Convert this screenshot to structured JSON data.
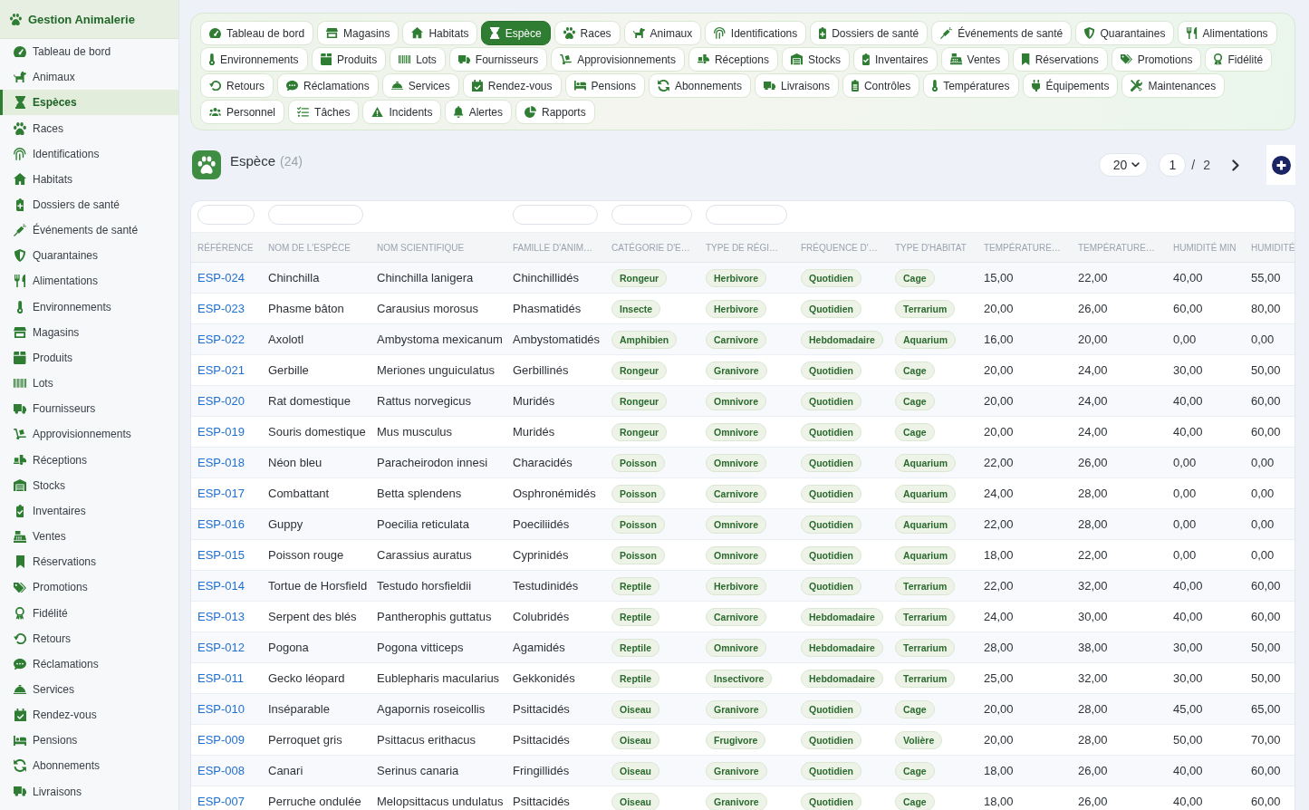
{
  "sidebar": {
    "title": "Gestion Animalerie",
    "items": [
      {
        "label": "Tableau de bord",
        "selected": false
      },
      {
        "label": "Animaux",
        "selected": false
      },
      {
        "label": "Espèces",
        "selected": true
      },
      {
        "label": "Races",
        "selected": false
      },
      {
        "label": "Identifications",
        "selected": false
      },
      {
        "label": "Habitats",
        "selected": false
      },
      {
        "label": "Dossiers de santé",
        "selected": false
      },
      {
        "label": "Événements de santé",
        "selected": false
      },
      {
        "label": "Quarantaines",
        "selected": false
      },
      {
        "label": "Alimentations",
        "selected": false
      },
      {
        "label": "Environnements",
        "selected": false
      },
      {
        "label": "Magasins",
        "selected": false
      },
      {
        "label": "Produits",
        "selected": false
      },
      {
        "label": "Lots",
        "selected": false
      },
      {
        "label": "Fournisseurs",
        "selected": false
      },
      {
        "label": "Approvisionnements",
        "selected": false
      },
      {
        "label": "Réceptions",
        "selected": false
      },
      {
        "label": "Stocks",
        "selected": false
      },
      {
        "label": "Inventaires",
        "selected": false
      },
      {
        "label": "Ventes",
        "selected": false
      },
      {
        "label": "Réservations",
        "selected": false
      },
      {
        "label": "Promotions",
        "selected": false
      },
      {
        "label": "Fidélité",
        "selected": false
      },
      {
        "label": "Retours",
        "selected": false
      },
      {
        "label": "Réclamations",
        "selected": false
      },
      {
        "label": "Services",
        "selected": false
      },
      {
        "label": "Rendez-vous",
        "selected": false
      },
      {
        "label": "Pensions",
        "selected": false
      },
      {
        "label": "Abonnements",
        "selected": false
      },
      {
        "label": "Livraisons",
        "selected": false
      }
    ]
  },
  "tabs": [
    {
      "label": "Tableau de bord",
      "selected": false
    },
    {
      "label": "Magasins",
      "selected": false
    },
    {
      "label": "Habitats",
      "selected": false
    },
    {
      "label": "Espèce",
      "selected": true
    },
    {
      "label": "Races",
      "selected": false
    },
    {
      "label": "Animaux",
      "selected": false
    },
    {
      "label": "Identifications",
      "selected": false
    },
    {
      "label": "Dossiers de santé",
      "selected": false
    },
    {
      "label": "Événements de santé",
      "selected": false
    },
    {
      "label": "Quarantaines",
      "selected": false
    },
    {
      "label": "Alimentations",
      "selected": false
    },
    {
      "label": "Environnements",
      "selected": false
    },
    {
      "label": "Produits",
      "selected": false
    },
    {
      "label": "Lots",
      "selected": false
    },
    {
      "label": "Fournisseurs",
      "selected": false
    },
    {
      "label": "Approvisionnements",
      "selected": false
    },
    {
      "label": "Réceptions",
      "selected": false
    },
    {
      "label": "Stocks",
      "selected": false
    },
    {
      "label": "Inventaires",
      "selected": false
    },
    {
      "label": "Ventes",
      "selected": false
    },
    {
      "label": "Réservations",
      "selected": false
    },
    {
      "label": "Promotions",
      "selected": false
    },
    {
      "label": "Fidélité",
      "selected": false
    },
    {
      "label": "Retours",
      "selected": false
    },
    {
      "label": "Réclamations",
      "selected": false
    },
    {
      "label": "Services",
      "selected": false
    },
    {
      "label": "Rendez-vous",
      "selected": false
    },
    {
      "label": "Pensions",
      "selected": false
    },
    {
      "label": "Abonnements",
      "selected": false
    },
    {
      "label": "Livraisons",
      "selected": false
    },
    {
      "label": "Contrôles",
      "selected": false
    },
    {
      "label": "Températures",
      "selected": false
    },
    {
      "label": "Équipements",
      "selected": false
    },
    {
      "label": "Maintenances",
      "selected": false
    },
    {
      "label": "Personnel",
      "selected": false
    },
    {
      "label": "Tâches",
      "selected": false
    },
    {
      "label": "Incidents",
      "selected": false
    },
    {
      "label": "Alertes",
      "selected": false
    },
    {
      "label": "Rapports",
      "selected": false
    }
  ],
  "header": {
    "title": "Espèce",
    "count": "(24)"
  },
  "pagination": {
    "page_size": "20",
    "page": "1",
    "separator": "/",
    "total_pages": "2"
  },
  "table": {
    "columns": [
      {
        "label": "RÉFÉRENCE",
        "kind": "link",
        "filter": true
      },
      {
        "label": "NOM DE L'ESPÈCE",
        "kind": "text",
        "filter": true
      },
      {
        "label": "NOM SCIENTIFIQUE",
        "kind": "text",
        "filter": false
      },
      {
        "label": "FAMILLE D'ANIM…",
        "kind": "text",
        "filter": true
      },
      {
        "label": "CATÉGORIE D'E…",
        "kind": "badge",
        "filter": true
      },
      {
        "label": "TYPE DE RÉGI…",
        "kind": "badge",
        "filter": true
      },
      {
        "label": "FRÉQUENCE D'…",
        "kind": "badge",
        "filter": false
      },
      {
        "label": "TYPE D'HABITAT",
        "kind": "badge",
        "filter": false
      },
      {
        "label": "TEMPÉRATURE…",
        "kind": "text",
        "filter": false
      },
      {
        "label": "TEMPÉRATURE…",
        "kind": "text",
        "filter": false
      },
      {
        "label": "HUMIDITÉ MIN",
        "kind": "text",
        "filter": false
      },
      {
        "label": "HUMIDITÉ",
        "kind": "text",
        "filter": false
      }
    ],
    "rows": [
      [
        "ESP-024",
        "Chinchilla",
        "Chinchilla lanigera",
        "Chinchillidés",
        "Rongeur",
        "Herbivore",
        "Quotidien",
        "Cage",
        "15,00",
        "22,00",
        "40,00",
        "55,00"
      ],
      [
        "ESP-023",
        "Phasme bâton",
        "Carausius morosus",
        "Phasmatidés",
        "Insecte",
        "Herbivore",
        "Quotidien",
        "Terrarium",
        "20,00",
        "26,00",
        "60,00",
        "80,00"
      ],
      [
        "ESP-022",
        "Axolotl",
        "Ambystoma mexicanum",
        "Ambystomatidés",
        "Amphibien",
        "Carnivore",
        "Hebdomadaire",
        "Aquarium",
        "16,00",
        "20,00",
        "0,00",
        "0,00"
      ],
      [
        "ESP-021",
        "Gerbille",
        "Meriones unguiculatus",
        "Gerbillinés",
        "Rongeur",
        "Granivore",
        "Quotidien",
        "Cage",
        "20,00",
        "24,00",
        "30,00",
        "50,00"
      ],
      [
        "ESP-020",
        "Rat domestique",
        "Rattus norvegicus",
        "Muridés",
        "Rongeur",
        "Omnivore",
        "Quotidien",
        "Cage",
        "20,00",
        "24,00",
        "40,00",
        "60,00"
      ],
      [
        "ESP-019",
        "Souris domestique",
        "Mus musculus",
        "Muridés",
        "Rongeur",
        "Omnivore",
        "Quotidien",
        "Cage",
        "20,00",
        "24,00",
        "40,00",
        "60,00"
      ],
      [
        "ESP-018",
        "Néon bleu",
        "Paracheirodon innesi",
        "Characidés",
        "Poisson",
        "Omnivore",
        "Quotidien",
        "Aquarium",
        "22,00",
        "26,00",
        "0,00",
        "0,00"
      ],
      [
        "ESP-017",
        "Combattant",
        "Betta splendens",
        "Osphronémidés",
        "Poisson",
        "Carnivore",
        "Quotidien",
        "Aquarium",
        "24,00",
        "28,00",
        "0,00",
        "0,00"
      ],
      [
        "ESP-016",
        "Guppy",
        "Poecilia reticulata",
        "Poeciliidés",
        "Poisson",
        "Omnivore",
        "Quotidien",
        "Aquarium",
        "22,00",
        "28,00",
        "0,00",
        "0,00"
      ],
      [
        "ESP-015",
        "Poisson rouge",
        "Carassius auratus",
        "Cyprinidés",
        "Poisson",
        "Omnivore",
        "Quotidien",
        "Aquarium",
        "18,00",
        "22,00",
        "0,00",
        "0,00"
      ],
      [
        "ESP-014",
        "Tortue de Horsfield",
        "Testudo horsfieldii",
        "Testudinidés",
        "Reptile",
        "Herbivore",
        "Quotidien",
        "Terrarium",
        "22,00",
        "32,00",
        "40,00",
        "60,00"
      ],
      [
        "ESP-013",
        "Serpent des blés",
        "Pantherophis guttatus",
        "Colubridés",
        "Reptile",
        "Carnivore",
        "Hebdomadaire",
        "Terrarium",
        "24,00",
        "30,00",
        "40,00",
        "60,00"
      ],
      [
        "ESP-012",
        "Pogona",
        "Pogona vitticeps",
        "Agamidés",
        "Reptile",
        "Omnivore",
        "Hebdomadaire",
        "Terrarium",
        "28,00",
        "38,00",
        "30,00",
        "50,00"
      ],
      [
        "ESP-011",
        "Gecko léopard",
        "Eublepharis macularius",
        "Gekkonidés",
        "Reptile",
        "Insectivore",
        "Hebdomadaire",
        "Terrarium",
        "25,00",
        "32,00",
        "30,00",
        "50,00"
      ],
      [
        "ESP-010",
        "Inséparable",
        "Agapornis roseicollis",
        "Psittacidés",
        "Oiseau",
        "Granivore",
        "Quotidien",
        "Cage",
        "20,00",
        "28,00",
        "45,00",
        "65,00"
      ],
      [
        "ESP-009",
        "Perroquet gris",
        "Psittacus erithacus",
        "Psittacidés",
        "Oiseau",
        "Frugivore",
        "Quotidien",
        "Volière",
        "20,00",
        "28,00",
        "50,00",
        "70,00"
      ],
      [
        "ESP-008",
        "Canari",
        "Serinus canaria",
        "Fringillidés",
        "Oiseau",
        "Granivore",
        "Quotidien",
        "Cage",
        "18,00",
        "26,00",
        "40,00",
        "60,00"
      ],
      [
        "ESP-007",
        "Perruche ondulée",
        "Melopsittacus undulatus",
        "Psittacidés",
        "Oiseau",
        "Granivore",
        "Quotidien",
        "Cage",
        "18,00",
        "26,00",
        "40,00",
        "60,00"
      ]
    ]
  }
}
